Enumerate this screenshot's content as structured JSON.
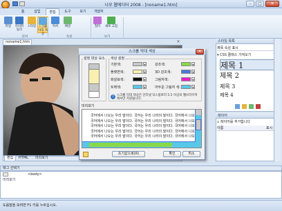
{
  "window": {
    "title": "나모 웹에디터 2008 - [noname1.htm]",
    "min": "–",
    "max": "□",
    "close": "✕"
  },
  "tabs": [
    "홈",
    "삽입",
    "편집",
    "도구",
    "보기",
    "개발자"
  ],
  "ribbon": {
    "buttons": [
      {
        "label": "파일",
        "color": "#5a8fd0",
        "selected": false
      },
      {
        "label": "하이퍼링크",
        "color": "#3a77c4",
        "selected": false
      },
      {
        "label": "스타일",
        "color": "#e8b33a",
        "selected": false
      },
      {
        "label": "스크롤 막대 색상",
        "color": "#5fa7e0",
        "selected": true
      },
      {
        "label": "커서",
        "color": "#4a8cd8",
        "selected": false
      },
      {
        "label": "배경",
        "color": "#6fb86f",
        "selected": false
      },
      {
        "label": "필터",
        "color": "#c06fd6",
        "selected": false
      },
      {
        "label": "새로 고침",
        "color": "#4caf50",
        "selected": false
      }
    ],
    "groups": [
      "문서",
      "속성",
      "보기"
    ]
  },
  "document": {
    "tab": "noname1.htm",
    "bottom_tabs": [
      "편집",
      "HTML",
      "미리보기"
    ]
  },
  "dialog": {
    "title": "스크롤 막대 색상",
    "group_preview_label": "설정 대상 요소",
    "group_color_label": "색상 설정",
    "colors": [
      {
        "label": "기본색:",
        "color": "#c8c8c8"
      },
      {
        "label": "강조색:",
        "color": "#88d848"
      },
      {
        "label": "플랫면색:",
        "color": "#f8f0b0"
      },
      {
        "label": "3D 강조색:",
        "color": "#4878d8"
      },
      {
        "label": "화살표색:",
        "color": "#101010"
      },
      {
        "label": "그림자색:",
        "color": "#e820c8"
      },
      {
        "label": "트랙색:",
        "color": "#58c8e8"
      },
      {
        "label": "어두운 그림자 색:",
        "color": "#58c8e8"
      }
    ],
    "info_text": "스크롤 막대 색상은 인터넷 익스플로러 5.5 이상의 웹브라우저에서만 지원됩니다.",
    "preview_label": "미리보기",
    "preview_line": "국어에서 나오는 우리 말이다. 국어는 우리 나라의 말이다. 국어에서 나오",
    "preview_lines_count": 5,
    "buttons": {
      "reset": "초기값으로(R)",
      "ok": "확인",
      "cancel": "취소"
    }
  },
  "style_panel": {
    "title": "스타일 목록",
    "tab": "제목 속성 표시",
    "subtitle": "CSS 클래스 가져오기",
    "headings": [
      "제목 1",
      "제목 2",
      "제목 3",
      "제목 4"
    ]
  },
  "layer_panel": {
    "title": "레이어",
    "header": "레이어를 추가합니다",
    "col_name": "이름",
    "col_vis": "표시"
  },
  "bottom": {
    "panel_title": "태그 선택기",
    "tag_row": "<body>",
    "status": "도움말을 보려면 F1 키를 누르십시오.",
    "right_tab": "미리보기"
  }
}
